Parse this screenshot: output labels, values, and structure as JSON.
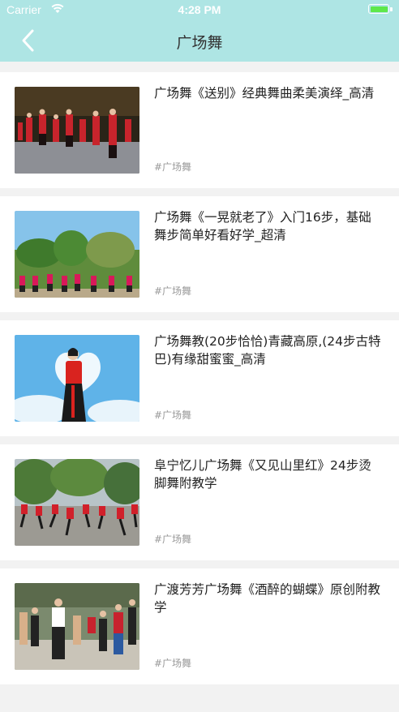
{
  "status_bar": {
    "carrier": "Carrier",
    "time": "4:28 PM",
    "battery_color": "#5ee84a"
  },
  "nav": {
    "title": "广场舞",
    "back_icon": "chevron-left-icon",
    "background": "#aee5e4"
  },
  "videos": [
    {
      "title": "广场舞《送别》经典舞曲柔美演绎_高清",
      "tag": "#广场舞"
    },
    {
      "title": "广场舞《一晃就老了》入门16步，基础舞步简单好看好学_超清",
      "tag": "#广场舞"
    },
    {
      "title": "广场舞教(20步恰恰)青藏高原,(24步古特巴)有缘甜蜜蜜_高清",
      "tag": "#广场舞"
    },
    {
      "title": "阜宁忆儿广场舞《又见山里红》24步烫脚舞附教学",
      "tag": "#广场舞"
    },
    {
      "title": "广渡芳芳广场舞《酒醉的蝴蝶》原创附教学",
      "tag": "#广场舞"
    }
  ]
}
